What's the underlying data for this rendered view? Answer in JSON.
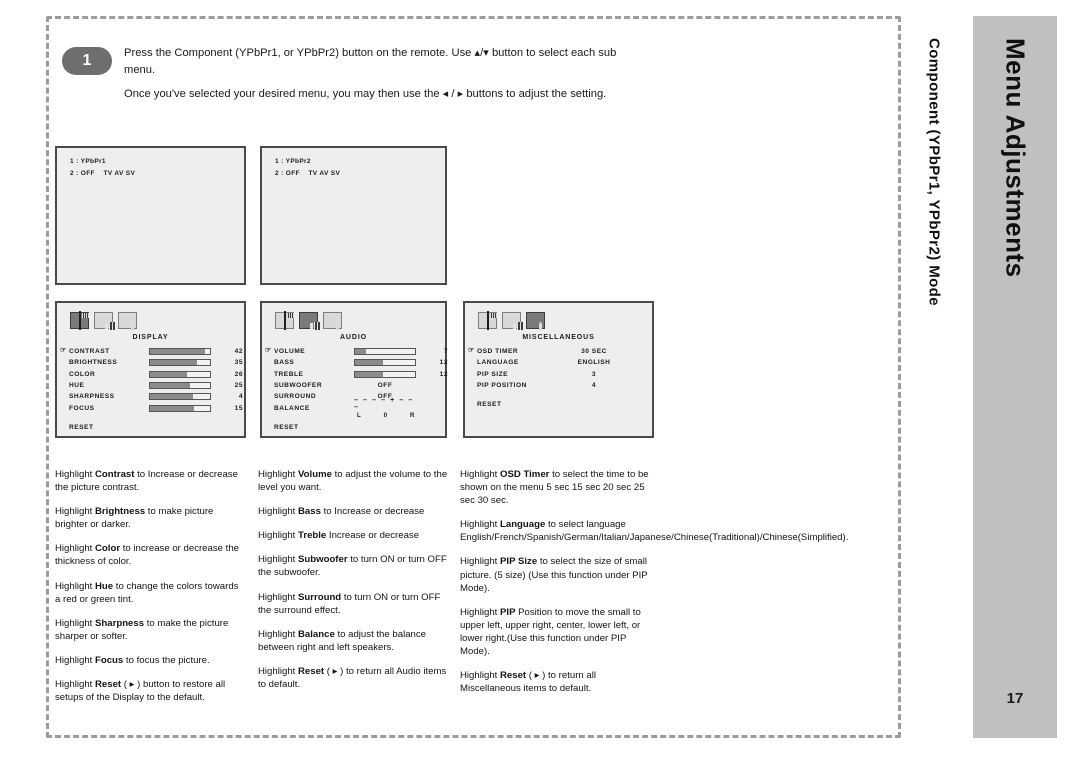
{
  "side": {
    "title": "Menu Adjustments",
    "subtitle": "Component (YPbPr1, YPbPr2) Mode",
    "page_number": "17",
    "tab_color": "#bfc0c2"
  },
  "step": {
    "number": "1",
    "line1": "Press the Component (YPbPr1, or YPbPr2) button on the remote. Use ▴/▾  button to select each sub",
    "line1b": "menu.",
    "line2": "Once you've selected your desired menu, you may then use the ◂ / ▸  buttons to adjust the setting."
  },
  "source_boxes": [
    {
      "name": "ypbpr1",
      "line1": "1 : YPbPr1",
      "line2": "2 : OFF    TV AV SV"
    },
    {
      "name": "ypbpr2",
      "line1": "1 : YPbPr2",
      "line2": "2 : OFF    TV AV SV"
    }
  ],
  "osd_panels": [
    {
      "id": "display",
      "title": "DISPLAY",
      "active_icon": 0,
      "icons": [
        "monitor-icon",
        "speaker-icon",
        "misc-icon"
      ],
      "rows": [
        {
          "label": "CONTRAST",
          "value": "42",
          "bar": 92,
          "cursor": true
        },
        {
          "label": "BRIGHTNESS",
          "value": "35",
          "bar": 78,
          "cursor": false
        },
        {
          "label": "COLOR",
          "value": "26",
          "bar": 62,
          "cursor": false
        },
        {
          "label": "HUE",
          "value": "25",
          "bar": 66,
          "cursor": false
        },
        {
          "label": "SHARPNESS",
          "value": "4",
          "bar": 72,
          "cursor": false
        },
        {
          "label": "FOCUS",
          "value": "15",
          "bar": 74,
          "cursor": false
        }
      ],
      "reset": "RESET</>"
    },
    {
      "id": "audio",
      "title": "AUDIO",
      "active_icon": 1,
      "icons": [
        "monitor-icon",
        "speaker-icon",
        "misc-icon"
      ],
      "rows": [
        {
          "label": "VOLUME",
          "value": "7",
          "bar": 18,
          "cursor": true
        },
        {
          "label": "BASS",
          "value": "12",
          "bar": 46,
          "cursor": false
        },
        {
          "label": "TREBLE",
          "value": "12",
          "bar": 46,
          "cursor": false
        },
        {
          "label": "SUBWOOFER",
          "text": "OFF",
          "cursor": false
        },
        {
          "label": "SURROUND",
          "text": "OFF",
          "cursor": false
        },
        {
          "label": "BALANCE",
          "balance": {
            "dashes": "– – – – + – – –",
            "left": "L",
            "center": "0",
            "right": "R"
          },
          "cursor": false
        }
      ],
      "reset": "RESET</>"
    },
    {
      "id": "miscellaneous",
      "title": "MISCELLANEOUS",
      "active_icon": 2,
      "icons": [
        "monitor-icon",
        "speaker-icon",
        "misc-icon"
      ],
      "rows": [
        {
          "label": "OSD TIMER",
          "text": "30 SEC",
          "cursor": true
        },
        {
          "label": "LANGUAGE",
          "text": "ENGLISH",
          "cursor": false
        },
        {
          "label": "PIP SIZE",
          "text": "3",
          "cursor": false
        },
        {
          "label": "PIP POSITION",
          "text": "4",
          "cursor": false
        }
      ],
      "reset": "RESET</>"
    }
  ],
  "descriptions": {
    "column1": [
      {
        "pre": "Highlight ",
        "bold": "Contrast",
        "post": " to Increase or decrease the picture contrast."
      },
      {
        "pre": "Highlight ",
        "bold": "Brightness",
        "post": " to make picture brighter or darker."
      },
      {
        "pre": "Highlight ",
        "bold": "Color",
        "post": " to increase or decrease the thickness of color."
      },
      {
        "pre": "Highlight ",
        "bold": "Hue",
        "post": " to change the colors towards a red or green tint."
      },
      {
        "pre": "Highlight ",
        "bold": "Sharpness",
        "post": " to make the picture sharper or softer."
      },
      {
        "pre": "Highlight ",
        "bold": "Focus",
        "post": " to focus the picture."
      },
      {
        "pre": "Highlight ",
        "bold": "Reset",
        "post": " ( ▸ ) button to restore all setups of the Display to the default."
      }
    ],
    "column2": [
      {
        "pre": "Highlight ",
        "bold": "Volume",
        "post": " to adjust the volume to the level you want."
      },
      {
        "pre": "Highlight ",
        "bold": "Bass",
        "post": " to Increase or decrease"
      },
      {
        "pre": "Highlight ",
        "bold": "Treble",
        "post": " Increase or decrease"
      },
      {
        "pre": "Highlight ",
        "bold": "Subwoofer",
        "post": " to turn ON or turn OFF the subwoofer."
      },
      {
        "pre": "Highlight ",
        "bold": "Surround",
        "post": " to turn ON or turn OFF the surround effect."
      },
      {
        "pre": "Highlight ",
        "bold": "Balance",
        "post": " to adjust the balance between right and left speakers."
      },
      {
        "pre": "Highlight ",
        "bold": "Reset",
        "post": " ( ▸ ) to return all Audio items to default."
      }
    ],
    "column3": [
      {
        "pre": "Highlight ",
        "bold": "OSD Timer",
        "post": " to select the time to be shown on the menu 5 sec 15 sec 20 sec 25 sec 30 sec."
      },
      {
        "pre": "Highlight ",
        "bold": "Language",
        "post": " to select language English/French/Spanish/German/Italian/Japanese/Chinese(Traditional)/Chinese(Simplified)."
      },
      {
        "pre": "Highlight ",
        "bold": "PIP Size",
        "post": " to select the size of small picture. (5 size) (Use this function under PIP Mode)."
      },
      {
        "pre": "Highlight ",
        "bold": "PIP",
        "post": " Position to move the small to upper left, upper right, center, lower left, or lower right.(Use this function under PIP Mode)."
      },
      {
        "pre": "Highlight ",
        "bold": "Reset",
        "post": " ( ▸ ) to return all Miscellaneous items to default."
      }
    ]
  }
}
